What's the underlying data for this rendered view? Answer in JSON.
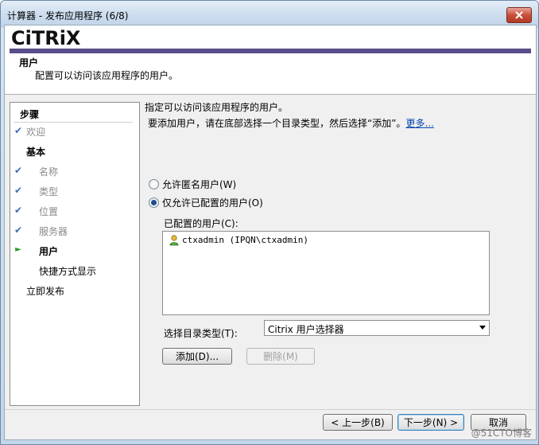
{
  "window": {
    "title": "计算器 - 发布应用程序 (6/8)"
  },
  "header": {
    "logo": "CiTRiX",
    "title": "用户",
    "subtitle": "配置可以访问该应用程序的用户。"
  },
  "steps": {
    "title": "步骤",
    "items": [
      {
        "label": "欢迎",
        "mark": "✔"
      },
      {
        "label": "基本",
        "mark": ""
      },
      {
        "label": "名称",
        "mark": "✔"
      },
      {
        "label": "类型",
        "mark": "✔"
      },
      {
        "label": "位置",
        "mark": "✔"
      },
      {
        "label": "服务器",
        "mark": "✔"
      },
      {
        "label": "用户",
        "mark": "►"
      },
      {
        "label": "快捷方式显示",
        "mark": ""
      },
      {
        "label": "立即发布",
        "mark": ""
      }
    ]
  },
  "content": {
    "line1": "指定可以访问该应用程序的用户。",
    "line2": "要添加用户，请在底部选择一个目录类型，然后选择“添加”。",
    "more_link": "更多...",
    "radio_anon": "允许匿名用户(W)",
    "radio_configured": "仅允许已配置的用户(O)",
    "configured_label": "已配置的用户(C):",
    "users": [
      "ctxadmin (IPQN\\ctxadmin)"
    ],
    "dir_type_label": "选择目录类型(T):",
    "dir_type_value": "Citrix 用户选择器",
    "add_button": "添加(D)...",
    "delete_button": "删除(M)"
  },
  "footer": {
    "back": "< 上一步(B)",
    "next": "下一步(N) >",
    "cancel": "取消",
    "watermark": "@51CTO博客"
  },
  "colors": {
    "purple_bar": "#5b4d8a",
    "check": "#3b6fb6",
    "arrow": "#2b9b2b"
  }
}
